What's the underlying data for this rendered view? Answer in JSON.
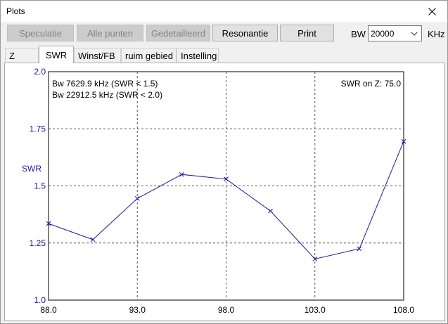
{
  "window": {
    "title": "Plots",
    "close_icon": "close-icon"
  },
  "toolbar": {
    "speculatie": "Speculatie",
    "alle_punten": "Alle punten",
    "gedetailleerd": "Gedetailleerd",
    "resonantie": "Resonantie",
    "print": "Print",
    "bw_label": "BW",
    "bw_value": "20000",
    "bw_unit": "KHz"
  },
  "tabs": [
    {
      "label": "Z",
      "active": false
    },
    {
      "label": "SWR",
      "active": true
    },
    {
      "label": "Winst/FB",
      "active": false
    },
    {
      "label": "ruim gebied",
      "active": false
    },
    {
      "label": "Instelling",
      "active": false
    }
  ],
  "chart_data": {
    "type": "line",
    "ylabel": "SWR",
    "xlabel": "",
    "xlim": [
      88.0,
      108.0
    ],
    "ylim": [
      1.0,
      2.0
    ],
    "x_ticks": [
      "88.0",
      "93.0",
      "98.0",
      "103.0",
      "108.0"
    ],
    "y_ticks": [
      "1.0",
      "1.25",
      "1.5",
      "1.75",
      "2.0"
    ],
    "grid": true,
    "annotations": {
      "bw_15": "Bw 7629.9 kHz (SWR < 1.5)",
      "bw_20": "Bw 22912.5 kHz (SWR < 2.0)",
      "swr_on_z": "SWR on Z: 75.0"
    },
    "series": [
      {
        "color": "#1a1aa0",
        "x": [
          88.0,
          90.5,
          93.0,
          95.5,
          98.0,
          100.5,
          103.0,
          105.5,
          108.0
        ],
        "y": [
          1.335,
          1.265,
          1.445,
          1.55,
          1.53,
          1.39,
          1.18,
          1.225,
          1.695
        ]
      }
    ]
  }
}
